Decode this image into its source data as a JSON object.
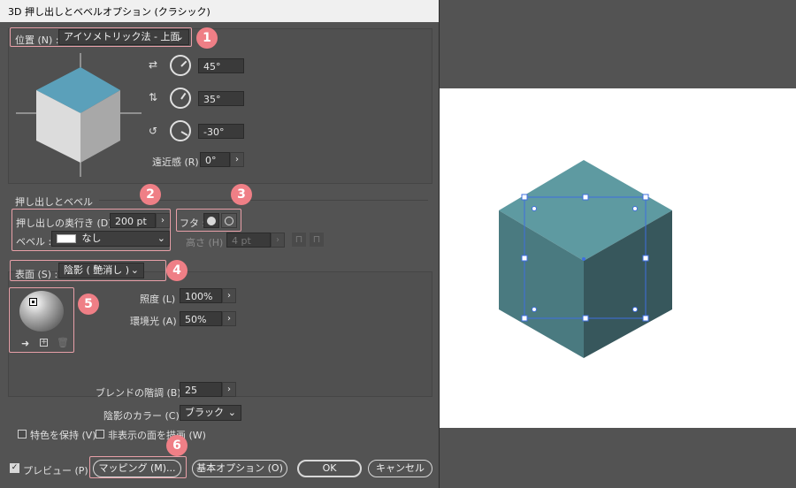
{
  "window": {
    "title": "3D 押し出しとベベルオプション (クラシック)"
  },
  "position": {
    "label": "位置 (N) :",
    "value": "アイソメトリック法 - 上面",
    "rot_x": "45°",
    "rot_y": "35°",
    "rot_z": "-30°",
    "perspective_label": "遠近感 (R):",
    "perspective_value": "0°"
  },
  "extrude": {
    "section_label": "押し出しとベベル",
    "depth_label": "押し出しの奥行き (D) :",
    "depth_value": "200 pt",
    "cap_label": "フタ :",
    "bevel_label": "ベベル :",
    "bevel_value": "なし",
    "height_label": "高さ (H) :",
    "height_value": "4 pt"
  },
  "surface": {
    "label": "表面 (S) :",
    "value": "陰影 ( 艶消し )",
    "intensity_label": "照度 (L) :",
    "intensity_value": "100%",
    "ambient_label": "環境光 (A) :",
    "ambient_value": "50%",
    "blend_label": "ブレンドの階調 (B) :",
    "blend_value": "25",
    "shade_color_label": "陰影のカラー (C) :",
    "shade_color_value": "ブラック",
    "preserve_spot_label": "特色を保持 (V)",
    "draw_hidden_label": "非表示の面を描画 (W)"
  },
  "footer": {
    "preview_label": "プレビュー (P)",
    "mapping_label": "マッピング (M)...",
    "basic_options_label": "基本オプション (O)",
    "ok_label": "OK",
    "cancel_label": "キャンセル"
  },
  "badges": [
    "1",
    "2",
    "3",
    "4",
    "5",
    "6"
  ],
  "colors": {
    "dialog_bg": "#535353",
    "highlight": "#ef7f86",
    "cube_top": "#5e9aa1",
    "cube_left": "#4a7a80",
    "cube_right": "#37575c",
    "selection": "#3f6fe0"
  }
}
